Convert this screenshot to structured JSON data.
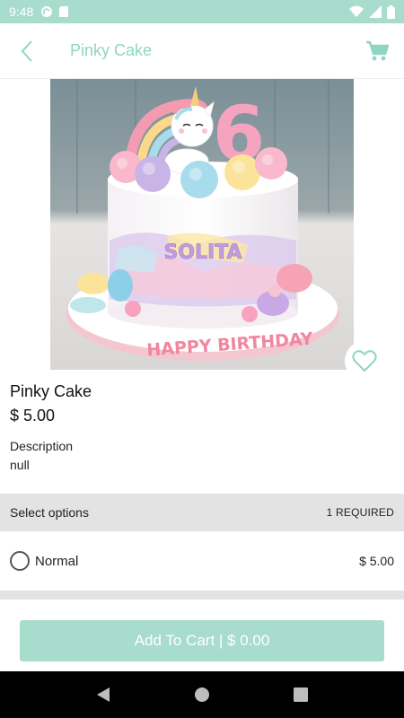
{
  "status_bar": {
    "time": "9:48"
  },
  "app_bar": {
    "title": "Pinky Cake",
    "back_icon": "chevron-left-icon",
    "cart_icon": "shopping-cart-icon"
  },
  "product": {
    "image_alt": "Unicorn rainbow birthday cake",
    "cake_name_text": "SOLITA",
    "cake_message": "HAPPY BIRTHDAY",
    "cake_number": "6",
    "name": "Pinky Cake",
    "price": "$ 5.00",
    "description_label": "Description",
    "description_value": "null"
  },
  "options": {
    "header": "Select options",
    "required": "1 REQUIRED",
    "items": [
      {
        "label": "Normal",
        "price": "$ 5.00"
      }
    ]
  },
  "add_to_cart": {
    "label": "Add To Cart | $ 0.00"
  },
  "colors": {
    "accent": "#a8dccd",
    "title_text": "#8fd5c3"
  }
}
